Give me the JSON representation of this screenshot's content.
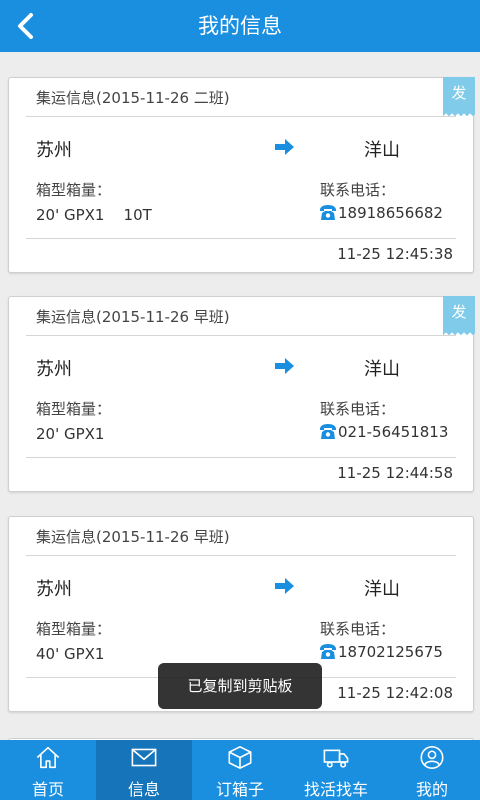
{
  "header": {
    "title": "我的信息"
  },
  "cards": [
    {
      "title": "集运信息(2015-11-26 二班)",
      "tag": "发",
      "origin": "苏州",
      "destination": "洋山",
      "box_label": "箱型箱量：",
      "box_value": "20' GPX1    10T",
      "phone_label": "联系电话：",
      "phone": "18918656682",
      "time": "11-25 12:45:38"
    },
    {
      "title": "集运信息(2015-11-26 早班)",
      "tag": "发",
      "origin": "苏州",
      "destination": "洋山",
      "box_label": "箱型箱量：",
      "box_value": "20' GPX1",
      "phone_label": "联系电话：",
      "phone": "021-56451813",
      "time": "11-25 12:44:58"
    },
    {
      "title": "集运信息(2015-11-26 早班)",
      "origin": "苏州",
      "destination": "洋山",
      "box_label": "箱型箱量：",
      "box_value": "40' GPX1",
      "phone_label": "联系电话：",
      "phone": "18702125675",
      "time": "11-25 12:42:08"
    }
  ],
  "toast": "已复制到剪贴板",
  "tabs": [
    {
      "label": "首页",
      "icon": "home-icon"
    },
    {
      "label": "信息",
      "icon": "envelope-icon",
      "active": true
    },
    {
      "label": "订箱子",
      "icon": "box-icon"
    },
    {
      "label": "找活找车",
      "icon": "truck-icon"
    },
    {
      "label": "我的",
      "icon": "user-icon"
    }
  ],
  "colors": {
    "primary": "#1a8fe0",
    "active_tab": "#1574ba",
    "tag": "#7fcbe9",
    "accent": "#1a8fe0"
  }
}
